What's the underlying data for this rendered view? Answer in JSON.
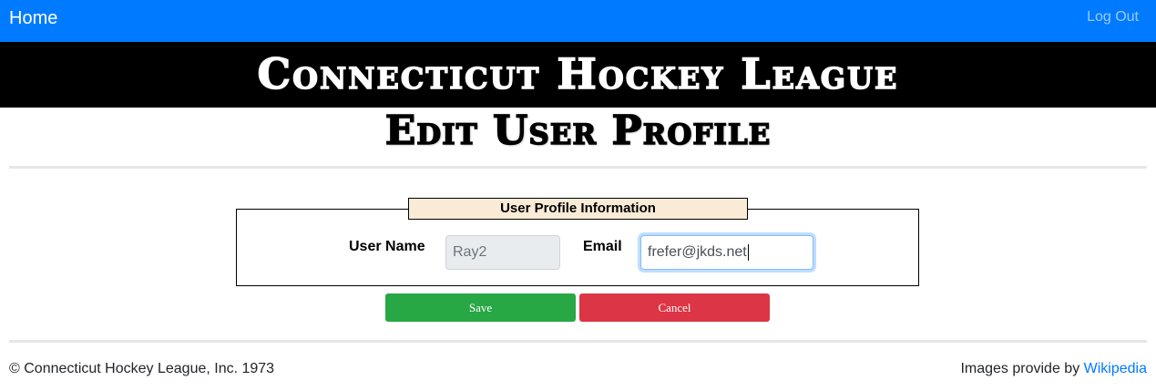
{
  "navbar": {
    "home_label": "Home",
    "logout_label": "Log Out",
    "background_color": "#007bff"
  },
  "banner": {
    "title": "Connecticut Hockey League"
  },
  "page": {
    "heading": "Edit User Profile"
  },
  "profile_form": {
    "legend": "User Profile Information",
    "username": {
      "label": "User Name",
      "value": "Ray2"
    },
    "email": {
      "label": "Email",
      "value": "frefer@jkds.net"
    },
    "save_label": "Save",
    "cancel_label": "Cancel",
    "save_color": "#28a745",
    "cancel_color": "#dc3545",
    "legend_color": "#faebd7"
  },
  "footer": {
    "copyright": "© Connecticut Hockey League, Inc. 1973",
    "credit_prefix": "Images provide by",
    "credit_link": "Wikipedia"
  }
}
